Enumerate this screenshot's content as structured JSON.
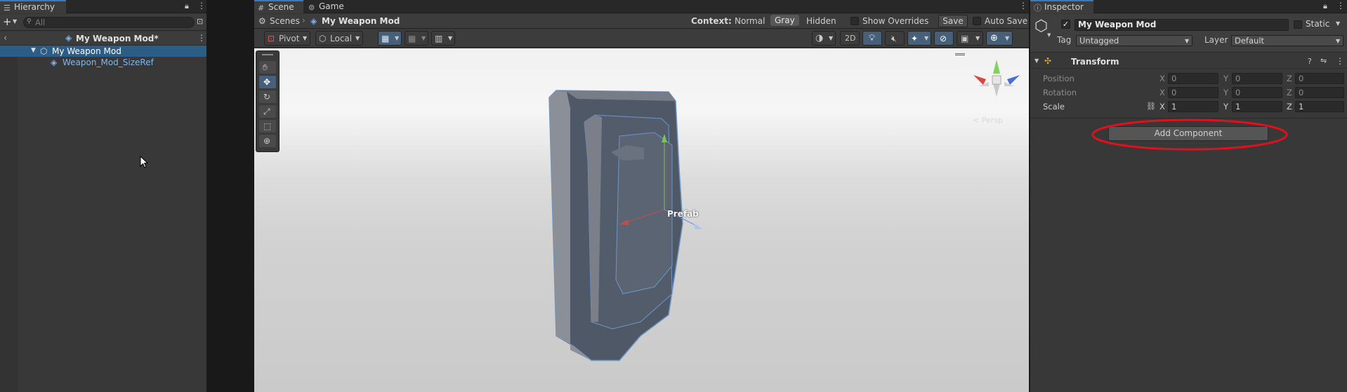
{
  "hierarchy": {
    "tab_label": "Hierarchy",
    "search_placeholder": "All",
    "breadcrumb_title": "My Weapon Mod*",
    "items": [
      {
        "label": "My Weapon Mod"
      },
      {
        "label": "Weapon_Mod_SizeRef"
      }
    ]
  },
  "scene": {
    "tabs": [
      {
        "label": "Scene"
      },
      {
        "label": "Game"
      }
    ],
    "breadcrumb": {
      "scenes_label": "Scenes",
      "current": "My Weapon Mod"
    },
    "context": {
      "label": "Context:",
      "options": [
        {
          "label": "Normal"
        },
        {
          "label": "Gray"
        },
        {
          "label": "Hidden"
        }
      ],
      "selected": "Gray"
    },
    "show_overrides_label": "Show Overrides",
    "save_label": "Save",
    "auto_save_label": "Auto Save",
    "pivot_label": "Pivot",
    "local_label": "Local",
    "mode_2d_label": "2D",
    "prefab_label": "Prefab",
    "persp_label": "< Persp",
    "tools": [
      {
        "icon": "hand-icon"
      },
      {
        "icon": "move-icon"
      },
      {
        "icon": "rotate-icon"
      },
      {
        "icon": "scale-icon"
      },
      {
        "icon": "rect-icon"
      },
      {
        "icon": "transform-icon"
      }
    ]
  },
  "inspector": {
    "tab_label": "Inspector",
    "object_name": "My Weapon Mod",
    "static_label": "Static",
    "tag_label": "Tag",
    "tag_value": "Untagged",
    "layer_label": "Layer",
    "layer_value": "Default",
    "transform": {
      "title": "Transform",
      "position": {
        "label": "Position",
        "x": "0",
        "y": "0",
        "z": "0"
      },
      "rotation": {
        "label": "Rotation",
        "x": "0",
        "y": "0",
        "z": "0"
      },
      "scale": {
        "label": "Scale",
        "x": "1",
        "y": "1",
        "z": "1"
      },
      "axis_x": "X",
      "axis_y": "Y",
      "axis_z": "Z"
    },
    "add_component_label": "Add Component",
    "highlight_color": "#e0101c"
  },
  "colors": {
    "selection": "#2c5d87",
    "accent": "#3a79bb",
    "prefab_blue": "#7fb6ef"
  }
}
